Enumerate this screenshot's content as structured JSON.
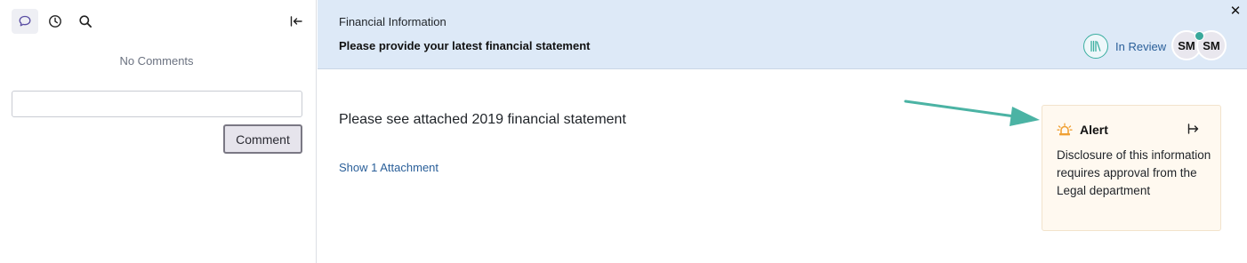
{
  "sidebar": {
    "tools": [
      {
        "icon": "comment-icon",
        "active": true
      },
      {
        "icon": "history-icon",
        "active": false
      },
      {
        "icon": "search-icon",
        "active": false
      }
    ],
    "collapse_icon": "collapse-left-icon",
    "empty_text": "No Comments",
    "comment_input": {
      "value": "",
      "placeholder": ""
    },
    "comment_button": "Comment"
  },
  "header": {
    "label": "Financial Information",
    "title": "Please provide your latest financial statement",
    "status": "In Review",
    "status_icon": "library-icon",
    "avatars": [
      "SM",
      "SM"
    ],
    "close_icon": "close-icon"
  },
  "main": {
    "response": "Please see attached 2019 financial statement",
    "attachment_link": "Show 1 Attachment"
  },
  "alert": {
    "icon": "siren-icon",
    "title": "Alert",
    "expand_icon": "expand-right-icon",
    "body": "Disclosure of this information requires approval from the Legal department"
  },
  "colors": {
    "header_bg": "#dde9f7",
    "accent_teal": "#3aaea0",
    "link_blue": "#2a5f99",
    "alert_bg": "#fff9f0",
    "alert_icon": "#f0a033"
  }
}
